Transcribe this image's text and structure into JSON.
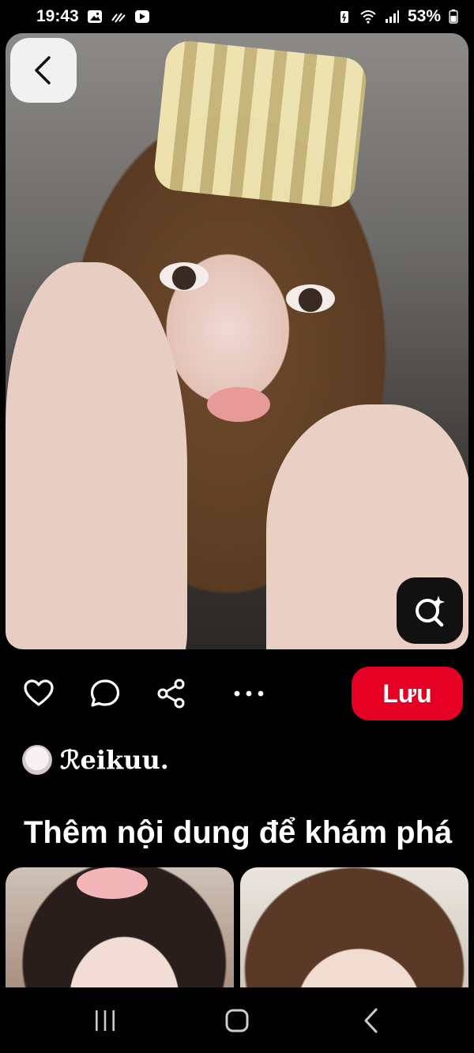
{
  "status_bar": {
    "time": "19:43",
    "battery": "53%",
    "left_icons": [
      "gallery-icon",
      "signal-activity-icon",
      "media-icon"
    ],
    "right_icons": [
      "battery-saver-icon",
      "wifi-icon",
      "cellular-signal-icon",
      "battery-icon"
    ]
  },
  "pin": {
    "image_icon_names": [
      "back-arrow-icon",
      "visual-search-icon"
    ],
    "actions": {
      "like_icon": "heart-icon",
      "comment_icon": "comment-bubble-icon",
      "share_icon": "share-icon",
      "more_icon": "more-options-icon",
      "save_label": "Lưu"
    },
    "author": {
      "name": "ℛeikuu."
    }
  },
  "related": {
    "title": "Thêm nội dung để khám phá"
  },
  "nav": {
    "icons": [
      "recent-apps-icon",
      "home-icon",
      "back-icon"
    ]
  },
  "colors": {
    "accent": "#e60023",
    "background": "#000000",
    "text": "#ffffff"
  }
}
